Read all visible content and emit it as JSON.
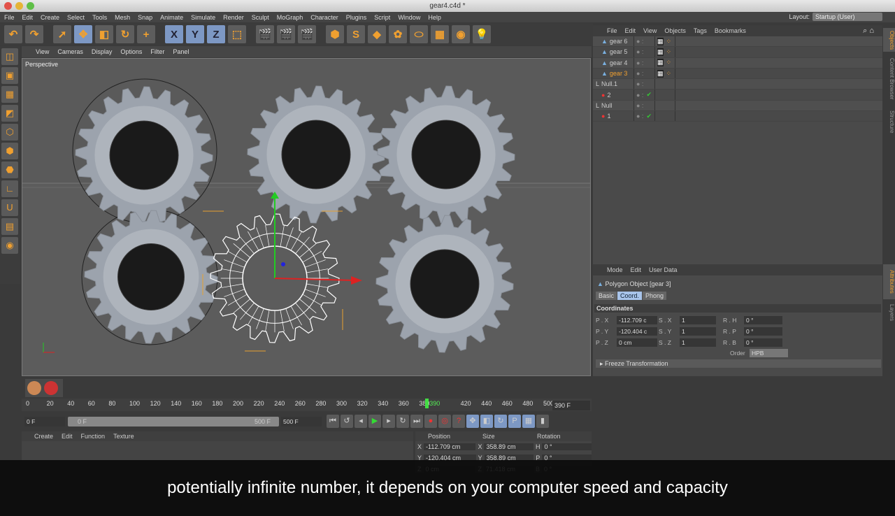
{
  "window": {
    "title": "gear4.c4d *"
  },
  "menu": [
    "File",
    "Edit",
    "Create",
    "Select",
    "Tools",
    "Mesh",
    "Snap",
    "Animate",
    "Simulate",
    "Render",
    "Sculpt",
    "MoGraph",
    "Character",
    "Plugins",
    "Script",
    "Window",
    "Help"
  ],
  "layout": {
    "label": "Layout:",
    "value": "Startup (User)"
  },
  "toolbar": [
    {
      "name": "undo-icon",
      "glyph": "↶",
      "active": false
    },
    {
      "name": "redo-icon",
      "glyph": "↷",
      "active": false
    },
    {
      "gap": true
    },
    {
      "name": "live-selection-icon",
      "glyph": "➚",
      "active": false
    },
    {
      "name": "move-icon",
      "glyph": "✥",
      "active": true
    },
    {
      "name": "scale-icon",
      "glyph": "◧",
      "active": false
    },
    {
      "name": "rotate-icon",
      "glyph": "↻",
      "active": false
    },
    {
      "name": "add-icon",
      "glyph": "+",
      "active": false
    },
    {
      "gap": true
    },
    {
      "name": "x-axis-icon",
      "glyph": "X",
      "active": true
    },
    {
      "name": "y-axis-icon",
      "glyph": "Y",
      "active": true
    },
    {
      "name": "z-axis-icon",
      "glyph": "Z",
      "active": true
    },
    {
      "name": "coordinate-system-icon",
      "glyph": "⬚",
      "active": false
    },
    {
      "gap": true
    },
    {
      "name": "render-view-icon",
      "glyph": "🎬",
      "active": false
    },
    {
      "name": "render-picture-viewer-icon",
      "glyph": "🎬",
      "active": false
    },
    {
      "name": "render-settings-icon",
      "glyph": "🎬",
      "active": false
    },
    {
      "gap": true
    },
    {
      "name": "cube-icon",
      "glyph": "⬢",
      "active": false
    },
    {
      "name": "spline-icon",
      "glyph": "S",
      "active": false
    },
    {
      "name": "subdivision-icon",
      "glyph": "◆",
      "active": false
    },
    {
      "name": "array-icon",
      "glyph": "✿",
      "active": false
    },
    {
      "name": "deformer-icon",
      "glyph": "⬭",
      "active": false
    },
    {
      "name": "floor-icon",
      "glyph": "▦",
      "active": false
    },
    {
      "name": "camera-icon",
      "glyph": "◉",
      "active": false
    },
    {
      "name": "light-icon",
      "glyph": "💡",
      "active": false
    }
  ],
  "viewport": {
    "menu": [
      "View",
      "Cameras",
      "Display",
      "Options",
      "Filter",
      "Panel"
    ],
    "camera": "Perspective"
  },
  "object_manager": {
    "menu": [
      "File",
      "Edit",
      "View",
      "Objects",
      "Tags",
      "Bookmarks"
    ],
    "objects": [
      {
        "name": "gear 6",
        "type": "polygon",
        "selected": false,
        "indent": 1
      },
      {
        "name": "gear 5",
        "type": "polygon",
        "selected": false,
        "indent": 1
      },
      {
        "name": "gear 4",
        "type": "polygon",
        "selected": false,
        "indent": 1
      },
      {
        "name": "gear 3",
        "type": "polygon",
        "selected": true,
        "indent": 1
      },
      {
        "name": "Null.1",
        "type": "null",
        "selected": false,
        "indent": 0
      },
      {
        "name": "2",
        "type": "gear",
        "selected": false,
        "indent": 1
      },
      {
        "name": "Null",
        "type": "null",
        "selected": false,
        "indent": 0
      },
      {
        "name": "1",
        "type": "gear",
        "selected": false,
        "indent": 1
      }
    ],
    "side_tabs": [
      "Objects",
      "Content Browser",
      "Structure"
    ]
  },
  "attributes": {
    "menu": [
      "Mode",
      "Edit",
      "User Data"
    ],
    "object_title": "Polygon Object [gear 3]",
    "tabs": [
      "Basic",
      "Coord.",
      "Phong"
    ],
    "active_tab": "Coord.",
    "section": "Coordinates",
    "fields": [
      {
        "label": "P . X",
        "value": "-112.709 c"
      },
      {
        "label": "S . X",
        "value": "1"
      },
      {
        "label": "R . H",
        "value": "0 °"
      },
      {
        "label": "P . Y",
        "value": "-120.404 c"
      },
      {
        "label": "S . Y",
        "value": "1"
      },
      {
        "label": "R . P",
        "value": "0 °"
      },
      {
        "label": "P . Z",
        "value": "0 cm"
      },
      {
        "label": "S . Z",
        "value": "1"
      },
      {
        "label": "R . B",
        "value": "0 °"
      }
    ],
    "order_label": "Order",
    "order_value": "HPB",
    "freeze": "Freeze Transformation",
    "side_tabs": [
      "Attributes",
      "Layers"
    ]
  },
  "timeline": {
    "ticks": [
      "0",
      "20",
      "40",
      "60",
      "80",
      "100",
      "120",
      "140",
      "160",
      "180",
      "200",
      "220",
      "240",
      "260",
      "280",
      "300",
      "320",
      "340",
      "360",
      "380",
      "390",
      "420",
      "440",
      "460",
      "480",
      "500"
    ],
    "current_frame": 390,
    "max_frame": 500,
    "current_label": "390 F"
  },
  "transport": {
    "start": "0 F",
    "range_start": "0 F",
    "range_end": "500 F",
    "end": "500 F"
  },
  "material_manager": {
    "menu": [
      "Create",
      "Edit",
      "Function",
      "Texture"
    ]
  },
  "coordinate_manager": {
    "headers": [
      "Position",
      "Size",
      "Rotation"
    ],
    "rows": [
      {
        "axis": "X",
        "pos": "-112.709 cm",
        "size_axis": "X",
        "size": "358.89 cm",
        "rot_axis": "H",
        "rot": "0 °"
      },
      {
        "axis": "Y",
        "pos": "-120.404 cm",
        "size_axis": "Y",
        "size": "358.89 cm",
        "rot_axis": "P",
        "rot": "0 °"
      },
      {
        "axis": "Z",
        "pos": "0 cm",
        "size_axis": "Z",
        "size": "71.418 cm",
        "rot_axis": "B",
        "rot": "0 °"
      }
    ]
  },
  "subtitle": "potentially infinite number, it depends on your computer speed and capacity"
}
